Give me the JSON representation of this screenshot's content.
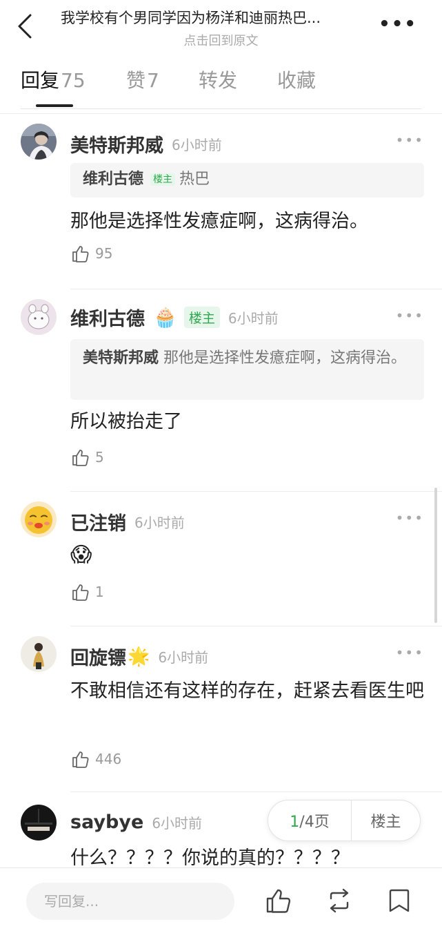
{
  "header": {
    "title": "我学校有个男同学因为杨洋和迪丽热巴...",
    "subtitle": "点击回到原文"
  },
  "tabs": [
    {
      "label": "回复",
      "count": "75",
      "active": true
    },
    {
      "label": "赞",
      "count": "7"
    },
    {
      "label": "转发",
      "count": ""
    },
    {
      "label": "收藏",
      "count": ""
    }
  ],
  "comments": [
    {
      "username": "美特斯邦威",
      "time": "6小时前",
      "quote": {
        "name": "维利古德",
        "badge": "楼主",
        "text": "热巴"
      },
      "text": "那他是选择性发癔症啊，这病得治。",
      "likes": "95"
    },
    {
      "username": "维利古德",
      "emoji": "🧁",
      "badge": "楼主",
      "time": "6小时前",
      "quote": {
        "name": "美特斯邦威",
        "text": "那他是选择性发癔症啊，这病得治。"
      },
      "text": "所以被抬走了",
      "likes": "5"
    },
    {
      "username": "已注销",
      "time": "6小时前",
      "text": "😱",
      "likes": "1"
    },
    {
      "username": "回旋镖",
      "emoji": "🌟",
      "time": "6小时前",
      "text": "不敢相信还有这样的存在，赶紧去看医生吧",
      "likes": "446"
    },
    {
      "username": "saybye",
      "time": "6小时前",
      "text": "什么？？？？你说的真的？？？？"
    }
  ],
  "pager": {
    "current": "1",
    "total_label": "/4页",
    "op_filter": "楼主"
  },
  "bottom_bar": {
    "reply_placeholder": "写回复..."
  },
  "colors": {
    "accent_green": "#2fa84f",
    "badge_bg": "#e6f6ea",
    "muted_text": "#999999"
  }
}
